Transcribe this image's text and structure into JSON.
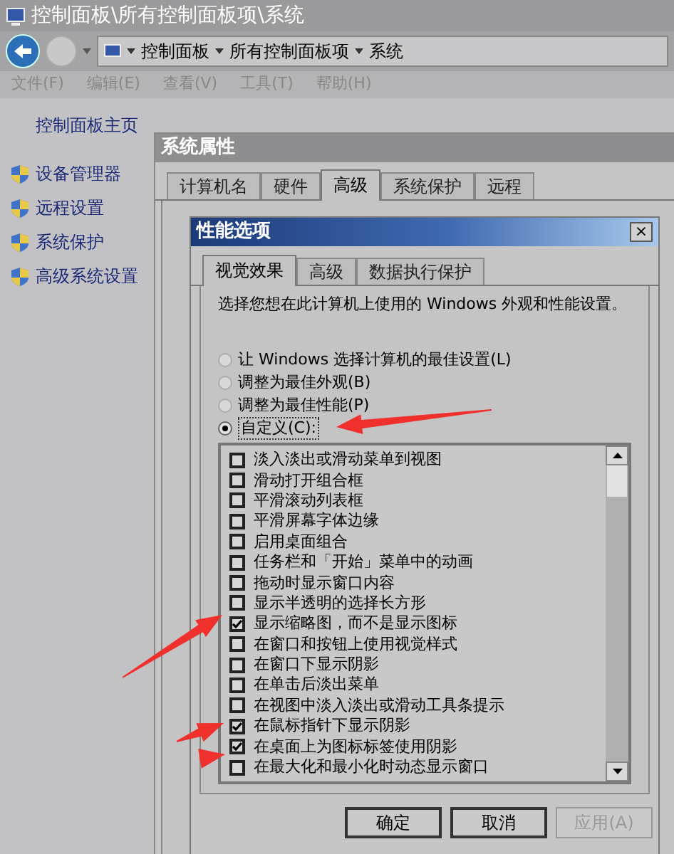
{
  "window": {
    "title": "控制面板\\所有控制面板项\\系统",
    "address_path": [
      "控制面板",
      "所有控制面板项",
      "系统"
    ],
    "menu": [
      "文件(F)",
      "编辑(E)",
      "查看(V)",
      "工具(T)",
      "帮助(H)"
    ]
  },
  "sidebar": {
    "home_link": "控制面板主页",
    "items": [
      "设备管理器",
      "远程设置",
      "系统保护",
      "高级系统设置"
    ]
  },
  "system_properties": {
    "title": "系统属性",
    "tabs": [
      {
        "label": "计算机名",
        "selected": false
      },
      {
        "label": "硬件",
        "selected": false
      },
      {
        "label": "高级",
        "selected": true
      },
      {
        "label": "系统保护",
        "selected": false
      },
      {
        "label": "远程",
        "selected": false
      }
    ]
  },
  "performance_options": {
    "title": "性能选项",
    "close": "×",
    "tabs": [
      {
        "label": "视觉效果",
        "selected": true
      },
      {
        "label": "高级",
        "selected": false
      },
      {
        "label": "数据执行保护",
        "selected": false
      }
    ],
    "description": "选择您想在此计算机上使用的 Windows 外观和性能设置。",
    "radios": [
      {
        "label": "让 Windows 选择计算机的最佳设置(L)",
        "selected": false
      },
      {
        "label": "调整为最佳外观(B)",
        "selected": false
      },
      {
        "label": "调整为最佳性能(P)",
        "selected": false
      },
      {
        "label": "自定义(C):",
        "selected": true
      }
    ],
    "effects": [
      {
        "label": "淡入淡出或滑动菜单到视图",
        "checked": false
      },
      {
        "label": "滑动打开组合框",
        "checked": false
      },
      {
        "label": "平滑滚动列表框",
        "checked": false
      },
      {
        "label": "平滑屏幕字体边缘",
        "checked": false
      },
      {
        "label": "启用桌面组合",
        "checked": false
      },
      {
        "label": "任务栏和「开始」菜单中的动画",
        "checked": false
      },
      {
        "label": "拖动时显示窗口内容",
        "checked": false
      },
      {
        "label": "显示半透明的选择长方形",
        "checked": false
      },
      {
        "label": "显示缩略图，而不是显示图标",
        "checked": true
      },
      {
        "label": "在窗口和按钮上使用视觉样式",
        "checked": false
      },
      {
        "label": "在窗口下显示阴影",
        "checked": false
      },
      {
        "label": "在单击后淡出菜单",
        "checked": false
      },
      {
        "label": "在视图中淡入淡出或滑动工具条提示",
        "checked": false
      },
      {
        "label": "在鼠标指针下显示阴影",
        "checked": true
      },
      {
        "label": "在桌面上为图标标签使用阴影",
        "checked": true
      },
      {
        "label": "在最大化和最小化时动态显示窗口",
        "checked": false
      }
    ],
    "buttons": [
      {
        "label": "确定",
        "disabled": false
      },
      {
        "label": "取消",
        "disabled": false
      },
      {
        "label": "应用(A)",
        "disabled": true
      }
    ]
  }
}
